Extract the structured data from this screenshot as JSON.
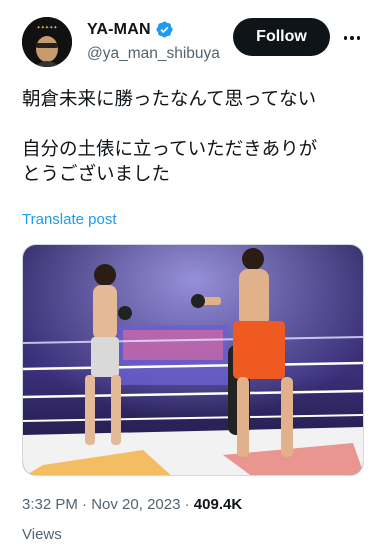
{
  "author": {
    "display_name": "YA-MAN",
    "handle": "@ya_man_shibuya",
    "verified": true,
    "avatar_icon": "avatar-portrait"
  },
  "actions": {
    "follow_label": "Follow",
    "more_icon": "more-horizontal-icon"
  },
  "tweet": {
    "paragraphs": [
      "朝倉未来に勝ったなんて思ってない",
      "自分の土俵に立っていただきありが\nとうございました"
    ],
    "translate_label": "Translate post"
  },
  "meta": {
    "time": "3:32 PM",
    "separator": " · ",
    "date": "Nov 20, 2023",
    "views_count": "409.4K",
    "views_label": "Views"
  },
  "colors": {
    "accent": "#1d9bf0",
    "text_primary": "#0f1419",
    "text_secondary": "#536471"
  }
}
